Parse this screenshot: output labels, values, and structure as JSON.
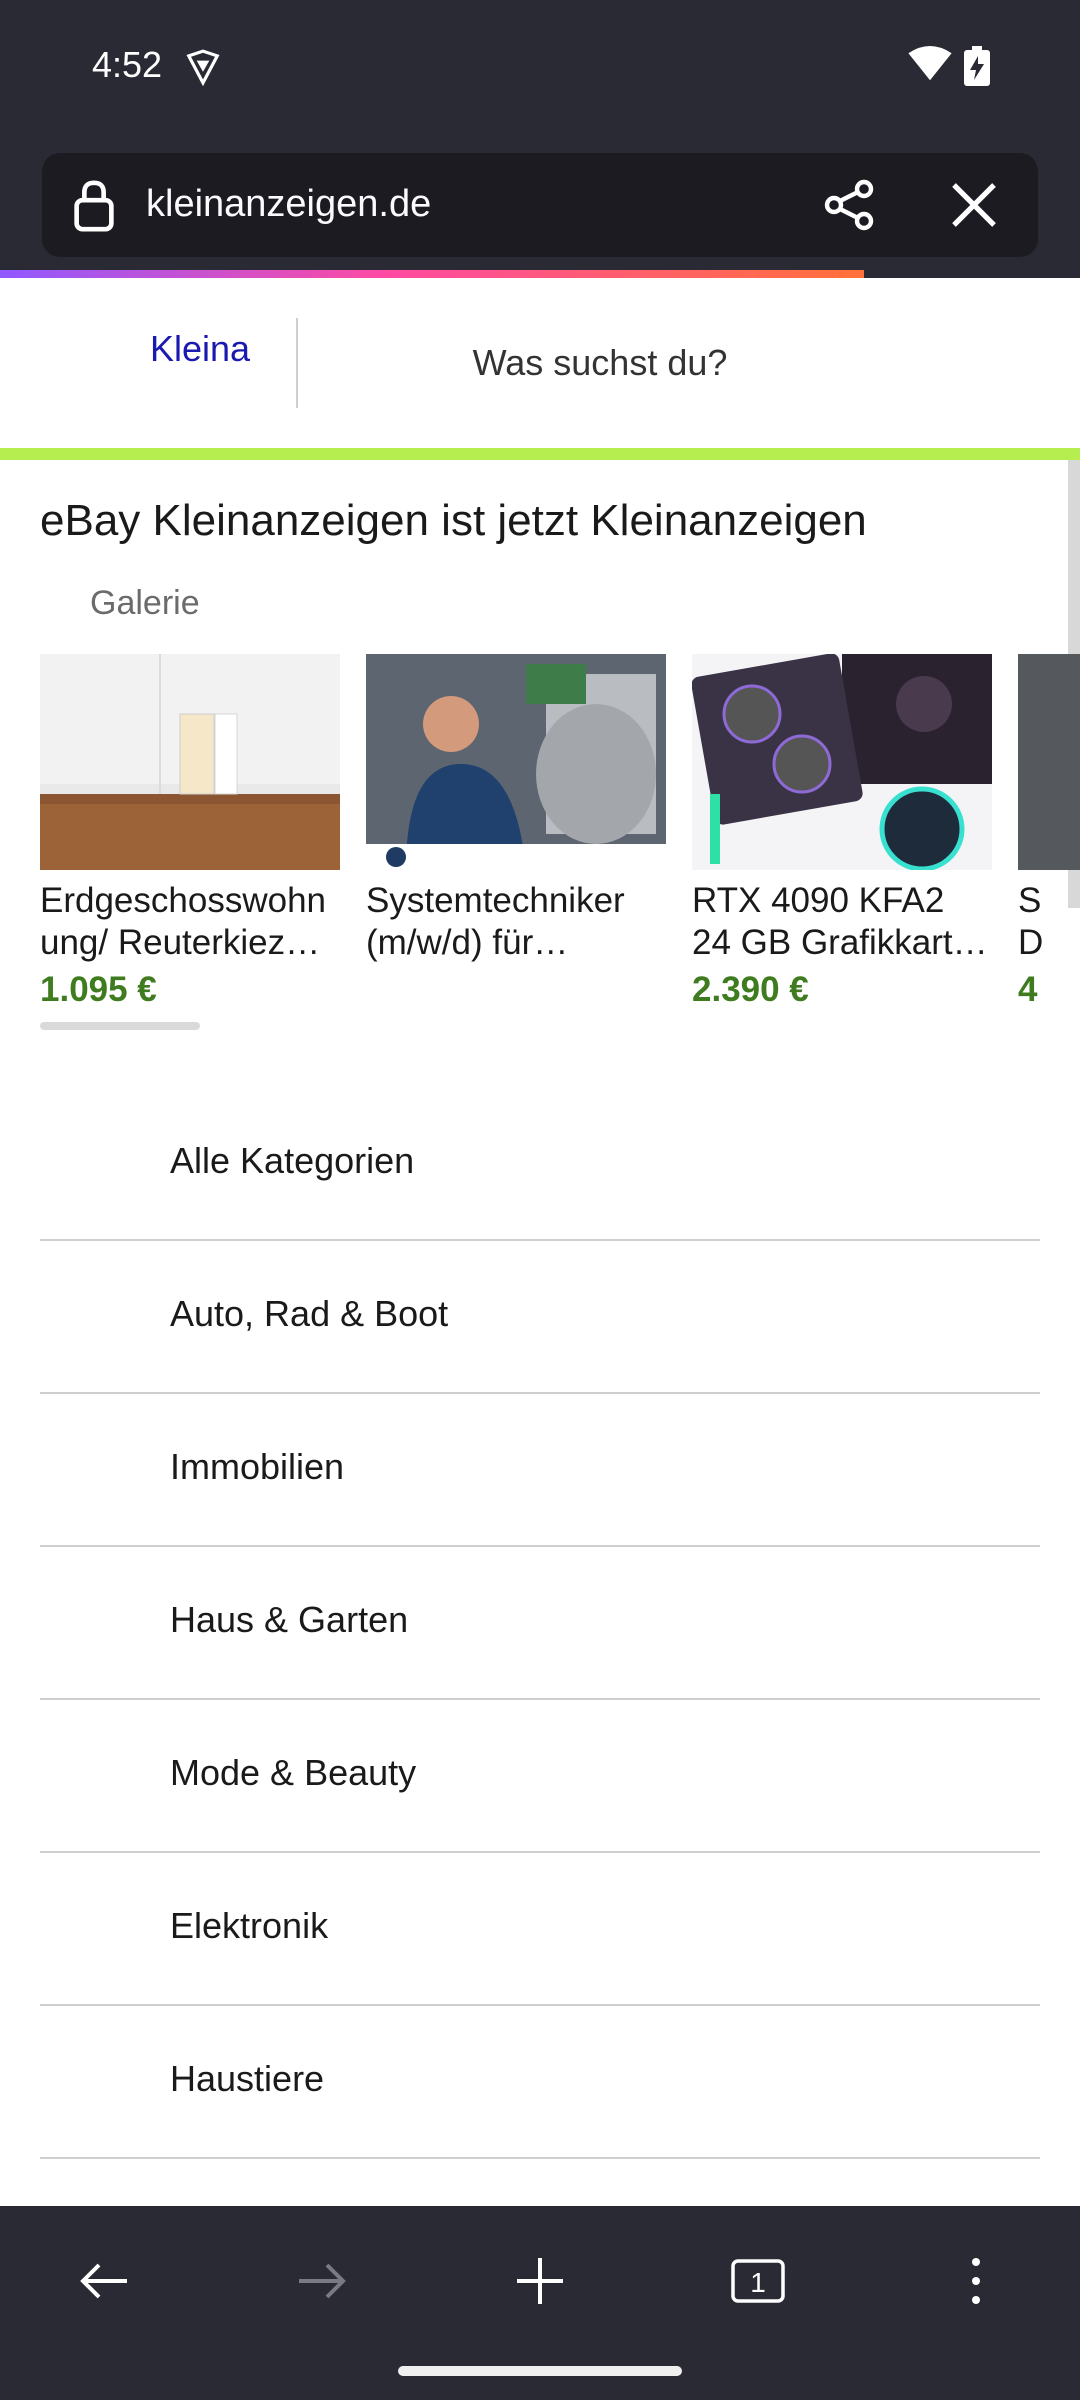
{
  "status_bar": {
    "time": "4:52"
  },
  "browser": {
    "url": "kleinanzeigen.de",
    "progress_fraction": 0.8
  },
  "site": {
    "logo_text": "Kleina",
    "search_placeholder": "Was suchst du?",
    "headline": "eBay Kleinanzeigen ist jetzt Kleinanzeigen",
    "gallery_label": "Galerie",
    "gallery_items": [
      {
        "title_line1": "Erdgeschosswohn",
        "title_line2": "ung/ Reuterkiez…",
        "price": "1.095 €"
      },
      {
        "title_line1": "Systemtechniker",
        "title_line2": "(m/w/d) für…",
        "price": ""
      },
      {
        "title_line1": "RTX 4090 KFA2",
        "title_line2": "24 GB Grafikkart…",
        "price": "2.390 €"
      },
      {
        "title_line1": "S",
        "title_line2": "D",
        "price": "4"
      }
    ],
    "categories": [
      "Alle Kategorien",
      "Auto, Rad & Boot",
      "Immobilien",
      "Haus & Garten",
      "Mode & Beauty",
      "Elektronik",
      "Haustiere"
    ]
  },
  "bottom_nav": {
    "tab_count": "1"
  },
  "colors": {
    "chrome": "#2a2a35",
    "price_green": "#3f7b1f",
    "accent_green": "#b6ee4f",
    "logo_blue": "#1a1ab0"
  }
}
